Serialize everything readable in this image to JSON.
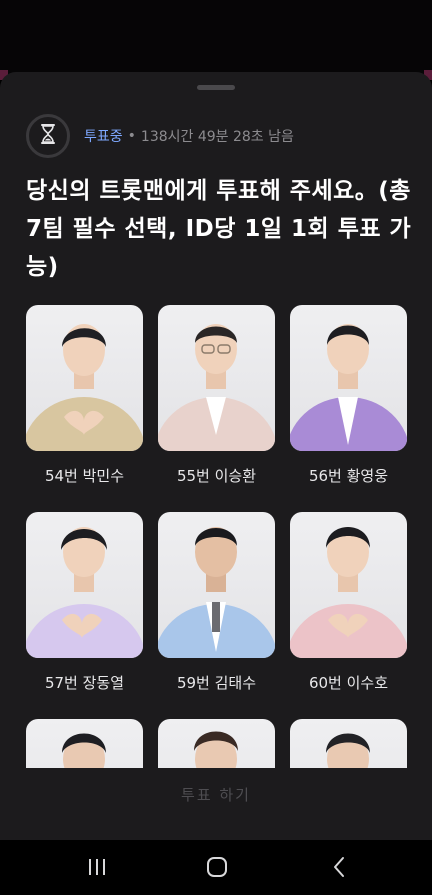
{
  "status": {
    "state_label": "투표중",
    "remaining": "138시간 49분 28초 남음"
  },
  "headline": "당신의 트롯맨에게 투표해 주세요。(총 7팀 필수 선택, ID당 1일 1회 투표 가능)",
  "candidates": [
    {
      "label": "54번 박민수",
      "outfit": "#d8c6a0"
    },
    {
      "label": "55번 이승환",
      "outfit": "#e8d2cc"
    },
    {
      "label": "56번 황영웅",
      "outfit": "#a98bd6"
    },
    {
      "label": "57번 장동열",
      "outfit": "#d6c8ee"
    },
    {
      "label": "59번 김태수",
      "outfit": "#a9c6ea"
    },
    {
      "label": "60번 이수호",
      "outfit": "#ecc3c8"
    }
  ],
  "vote_button": "투표 하기",
  "icons": {
    "timer": "hourglass-icon",
    "nav": [
      "recent-apps-icon",
      "home-icon",
      "back-icon"
    ]
  },
  "colors": {
    "accent": "#7ea8ff",
    "sheet_bg": "#1c1b1d"
  }
}
